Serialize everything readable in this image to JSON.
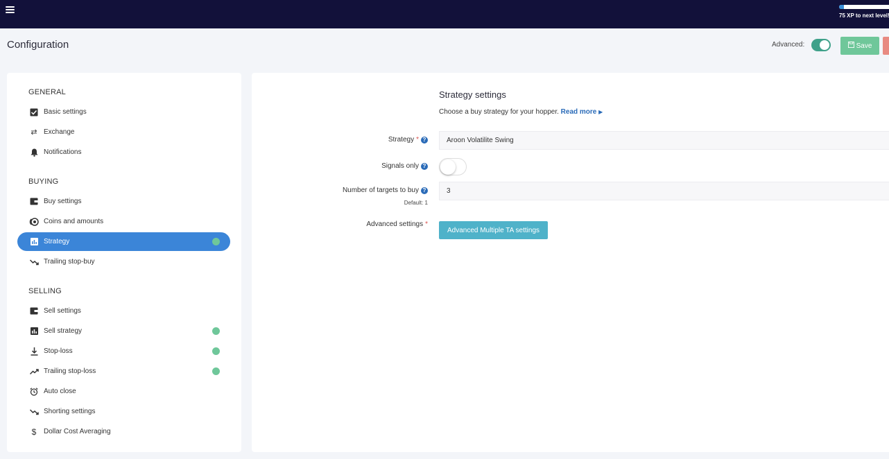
{
  "header": {
    "xp_text": "75 XP to next level!",
    "xp_progress": 0.1
  },
  "page": {
    "title": "Configuration",
    "advanced_label": "Advanced:",
    "advanced_on": true,
    "save_label": "Save"
  },
  "sidebar": {
    "sections": [
      {
        "heading": "GENERAL",
        "items": [
          {
            "label": "Basic settings",
            "icon": "checkbox-icon"
          },
          {
            "label": "Exchange",
            "icon": "exchange-arrows-icon"
          },
          {
            "label": "Notifications",
            "icon": "bell-icon"
          }
        ]
      },
      {
        "heading": "BUYING",
        "items": [
          {
            "label": "Buy settings",
            "icon": "wallet-icon"
          },
          {
            "label": "Coins and amounts",
            "icon": "coins-icon"
          },
          {
            "label": "Strategy",
            "icon": "bar-chart-icon",
            "active": true,
            "dot": true
          },
          {
            "label": "Trailing stop-buy",
            "icon": "trend-down-icon"
          }
        ]
      },
      {
        "heading": "SELLING",
        "items": [
          {
            "label": "Sell settings",
            "icon": "wallet-icon"
          },
          {
            "label": "Sell strategy",
            "icon": "bar-chart-icon",
            "dot": true
          },
          {
            "label": "Stop-loss",
            "icon": "arrow-down-bar-icon",
            "dot": true
          },
          {
            "label": "Trailing stop-loss",
            "icon": "trend-up-icon",
            "dot": true
          },
          {
            "label": "Auto close",
            "icon": "alarm-clock-icon"
          },
          {
            "label": "Shorting settings",
            "icon": "trend-down-icon"
          },
          {
            "label": "Dollar Cost Averaging",
            "icon": "dollar-icon"
          }
        ]
      }
    ]
  },
  "main": {
    "title": "Strategy settings",
    "subtitle": "Choose a buy strategy for your hopper.",
    "read_more": "Read more",
    "fields": {
      "strategy_label": "Strategy",
      "strategy_value": "Aroon Volatilite Swing",
      "signals_label": "Signals only",
      "signals_on": false,
      "targets_label": "Number of targets to buy",
      "targets_default": "Default: 1",
      "targets_value": "3",
      "advanced_label": "Advanced settings",
      "advanced_button": "Advanced Multiple TA settings"
    }
  },
  "colors": {
    "topbar": "#12113a",
    "active_nav": "#3b85d8",
    "status_dot": "#6fc79a",
    "save_button": "#6fc79a",
    "toggle_on": "#3fa18a",
    "link": "#2a6bb8",
    "ta_button": "#4fb2c9"
  }
}
